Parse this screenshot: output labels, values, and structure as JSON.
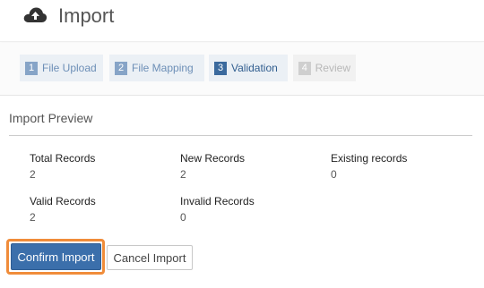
{
  "header": {
    "title": "Import",
    "icon": "cloud-upload-icon"
  },
  "steps": [
    {
      "num": "1",
      "label": "File Upload",
      "state": "done"
    },
    {
      "num": "2",
      "label": "File Mapping",
      "state": "done"
    },
    {
      "num": "3",
      "label": "Validation",
      "state": "active"
    },
    {
      "num": "4",
      "label": "Review",
      "state": "todo"
    }
  ],
  "preview": {
    "title": "Import Preview",
    "total_records": {
      "label": "Total Records",
      "value": "2"
    },
    "new_records": {
      "label": "New Records",
      "value": "2"
    },
    "existing_records": {
      "label": "Existing records",
      "value": "0"
    },
    "valid_records": {
      "label": "Valid Records",
      "value": "2"
    },
    "invalid_records": {
      "label": "Invalid Records",
      "value": "0"
    }
  },
  "actions": {
    "confirm_label": "Confirm Import",
    "cancel_label": "Cancel Import"
  },
  "colors": {
    "primary": "#3b6fab",
    "highlight": "#f08c3a",
    "step_active": "#3b6a9d",
    "step_done": "#86a4c7"
  }
}
